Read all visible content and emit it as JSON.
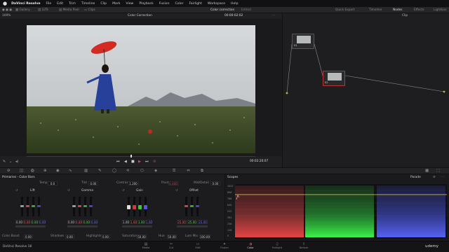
{
  "menubar": {
    "apple": "",
    "items": [
      "DaVinci Resolve",
      "File",
      "Edit",
      "Trim",
      "Timeline",
      "Clip",
      "Mark",
      "View",
      "Playback",
      "Fusion",
      "Color",
      "Fairlight",
      "Workspace",
      "Help"
    ]
  },
  "titlebar": {
    "tabs": [
      "Gallery",
      "LUTs",
      "Media Pool",
      "Clips"
    ],
    "project": "Color correction",
    "project_status": "Edited",
    "right_tabs": [
      "Quick Export",
      "Timeline",
      "Nodes",
      "Effects",
      "Lightbox"
    ]
  },
  "viewer": {
    "zoom": "109%",
    "title": "Color Correction",
    "timecode_top": "00:00:02:02",
    "timecode_bottom": "00:02:20:07"
  },
  "nodes": {
    "header": "Clip",
    "node1_label": "01",
    "node2_label": "02"
  },
  "primaries": {
    "title": "Primaries - Color Bars",
    "temp_label": "Temp",
    "temp_val": "0.0",
    "tint_label": "Tint",
    "tint_val": "0.00",
    "contrast_label": "Contrast",
    "contrast_val": "1.200",
    "pivot_label": "Pivot",
    "pivot_val": "0.400",
    "middetail_label": "Mid/Detail",
    "middetail_val": "0.00",
    "wheels": [
      {
        "name": "Lift",
        "values": [
          "0.00",
          "0.00",
          "0.00",
          "0.00"
        ]
      },
      {
        "name": "Gamma",
        "values": [
          "0.00",
          "0.00",
          "0.00",
          "0.00"
        ]
      },
      {
        "name": "Gain",
        "values": [
          "1.00",
          "1.00",
          "1.00",
          "1.00"
        ]
      },
      {
        "name": "Offset",
        "values": [
          "25.00",
          "25.00",
          "25.00"
        ]
      }
    ],
    "bottom": [
      {
        "label": "Color Boost",
        "val": "0.00"
      },
      {
        "label": "Shadows",
        "val": "0.00"
      },
      {
        "label": "Highlights",
        "val": "0.00"
      },
      {
        "label": "Saturation",
        "val": "50.00"
      },
      {
        "label": "Hue",
        "val": "50.00"
      },
      {
        "label": "Lum Mix",
        "val": "100.00"
      }
    ]
  },
  "scopes": {
    "title": "Scopes",
    "mode": "Parade",
    "scale": [
      "1023",
      "896",
      "768",
      "640",
      "512",
      "384",
      "256",
      "128",
      "0"
    ]
  },
  "pages": {
    "brand": "DaVinci Resolve 18",
    "items": [
      "Media",
      "Cut",
      "Edit",
      "Fusion",
      "Color",
      "Fairlight",
      "Deliver"
    ],
    "active": "Color",
    "watermark": "udemy"
  },
  "colors": {
    "accent": "#e0455a",
    "active_page": "#e0455a",
    "red": "#d24040",
    "green": "#2fbf3c",
    "blue": "#4a55e0"
  }
}
